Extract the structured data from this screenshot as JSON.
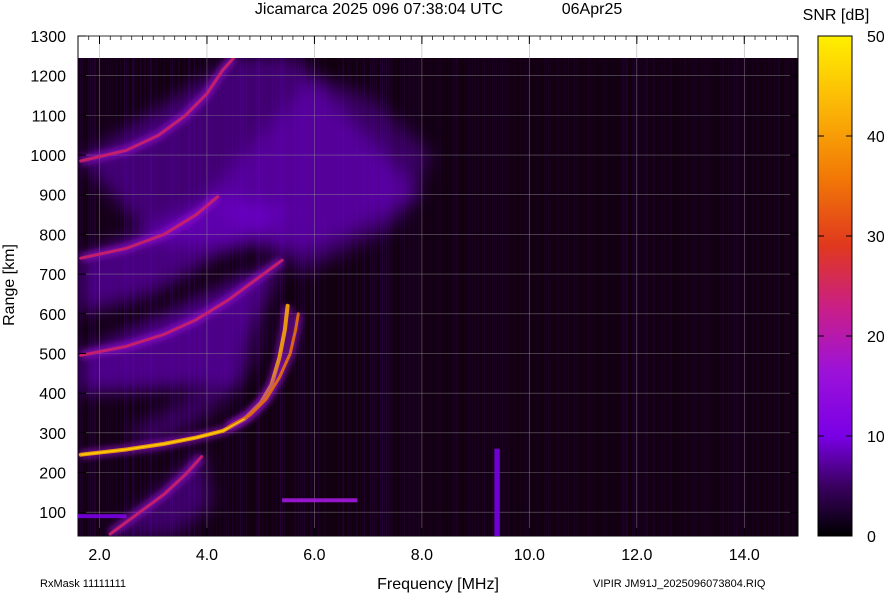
{
  "header": {
    "title": "Jicamarca 2025 096 07:38:04 UTC",
    "date": "06Apr25"
  },
  "footer": {
    "left": "RxMask 11111111",
    "right": "VIPIR  JM91J_2025096073804.RIQ"
  },
  "colors": {
    "background": "#120010",
    "grid": "#808080",
    "colormap": [
      "#000000",
      "#3a0060",
      "#7a00e6",
      "#9c12d8",
      "#c8206a",
      "#e85a08",
      "#f8a408",
      "#ffe600",
      "#fff200"
    ]
  },
  "chart_data": {
    "type": "heatmap",
    "title": "Jicamarca 2025 096 07:38:04 UTC",
    "xlabel": "Frequency [MHz]",
    "ylabel": "Range [km]",
    "xlim": [
      1.6,
      15.0
    ],
    "ylim": [
      40,
      1300
    ],
    "x_ticks": [
      2.0,
      4.0,
      6.0,
      8.0,
      10.0,
      12.0,
      14.0
    ],
    "x_tick_labels": [
      "2.0",
      "4.0",
      "6.0",
      "8.0",
      "10.0",
      "12.0",
      "14.0"
    ],
    "y_ticks": [
      100,
      200,
      300,
      400,
      500,
      600,
      700,
      800,
      900,
      1000,
      1100,
      1200,
      1300
    ],
    "y_tick_labels": [
      "100",
      "200",
      "300",
      "400",
      "500",
      "600",
      "700",
      "800",
      "900",
      "1000",
      "1100",
      "1200",
      "1300"
    ],
    "grid": true,
    "colorbar": {
      "label": "SNR [dB]",
      "range": [
        0,
        50
      ],
      "ticks": [
        0,
        10,
        20,
        30,
        40,
        50
      ],
      "tick_labels": [
        "0",
        "10",
        "20",
        "30",
        "40",
        "50"
      ]
    },
    "traces": [
      {
        "name": "",
        "points": [
          [
            1.65,
            245
          ],
          [
            2.5,
            258
          ],
          [
            3.2,
            272
          ],
          [
            3.8,
            288
          ],
          [
            4.3,
            305
          ],
          [
            4.7,
            335
          ],
          [
            5.0,
            375
          ],
          [
            5.2,
            420
          ],
          [
            5.35,
            490
          ],
          [
            5.45,
            560
          ],
          [
            5.5,
            620
          ]
        ]
      },
      {
        "name": "",
        "points": [
          [
            4.4,
            315
          ],
          [
            4.8,
            345
          ],
          [
            5.1,
            385
          ],
          [
            5.35,
            440
          ],
          [
            5.55,
            500
          ],
          [
            5.65,
            560
          ],
          [
            5.7,
            600
          ]
        ]
      },
      {
        "name": "",
        "points": [
          [
            1.65,
            495
          ],
          [
            2.5,
            518
          ],
          [
            3.2,
            548
          ],
          [
            3.8,
            585
          ],
          [
            4.4,
            635
          ],
          [
            5.0,
            695
          ],
          [
            5.4,
            735
          ]
        ]
      },
      {
        "name": "",
        "points": [
          [
            1.65,
            740
          ],
          [
            2.5,
            765
          ],
          [
            3.2,
            800
          ],
          [
            3.8,
            850
          ],
          [
            4.2,
            895
          ]
        ]
      },
      {
        "name": "",
        "points": [
          [
            1.65,
            985
          ],
          [
            2.5,
            1012
          ],
          [
            3.1,
            1050
          ],
          [
            3.6,
            1100
          ],
          [
            4.0,
            1155
          ],
          [
            4.3,
            1215
          ],
          [
            4.5,
            1245
          ]
        ]
      },
      {
        "name": "",
        "points": [
          [
            2.2,
            45
          ],
          [
            2.7,
            95
          ],
          [
            3.2,
            145
          ],
          [
            3.6,
            195
          ],
          [
            3.9,
            240
          ]
        ]
      }
    ],
    "patches": [
      {
        "x": [
          5.4,
          6.8
        ],
        "y": [
          125,
          135
        ],
        "snr": 14
      },
      {
        "x": [
          9.35,
          9.45
        ],
        "y": [
          40,
          260
        ],
        "snr": 9
      },
      {
        "x": [
          1.6,
          2.5
        ],
        "y": [
          85,
          95
        ],
        "snr": 8
      }
    ]
  }
}
